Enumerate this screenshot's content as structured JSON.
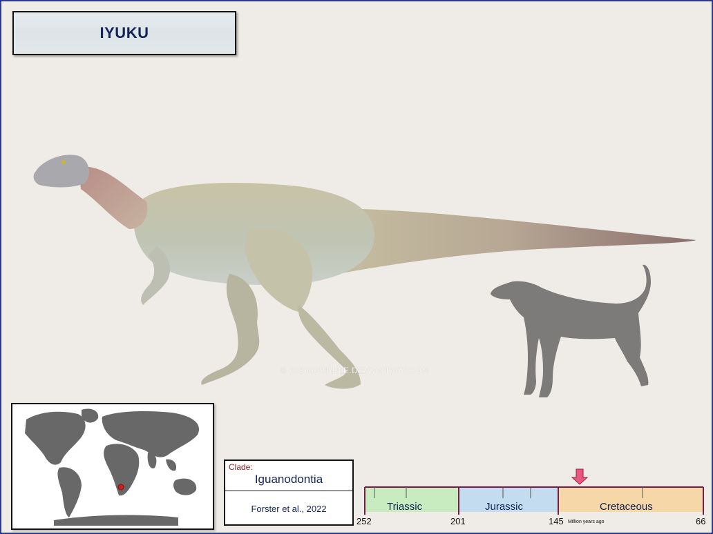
{
  "title": "IYUKU",
  "watermark": "© CISIOPURPLE.DEVIANTART.COM",
  "clade": {
    "label": "Clade:",
    "name": "Iguanodontia",
    "author": "Forster et al., 2022"
  },
  "timeline": {
    "periods": [
      {
        "name": "Triassic",
        "color": "#c9ebc0"
      },
      {
        "name": "Jurassic",
        "color": "#c4dcef"
      },
      {
        "name": "Cretaceous",
        "color": "#f6d7a8"
      }
    ],
    "ticks": [
      "252",
      "201",
      "145",
      "66"
    ],
    "unit_label": "Million years ago",
    "marker_color": "#e8577e"
  },
  "colors": {
    "frame": "#2a3a8a",
    "title_text": "#142457",
    "location_dot": "#d11f1f",
    "silhouette": "#7c7b79"
  },
  "icons": {
    "world_map": "world-map-icon",
    "location": "location-dot-icon",
    "scale": "dog-silhouette-icon",
    "arrow": "arrow-down-icon"
  }
}
